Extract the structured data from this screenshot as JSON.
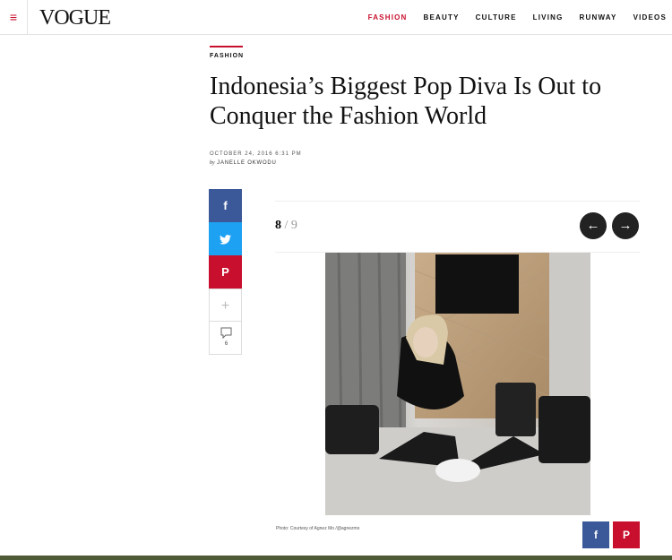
{
  "header": {
    "logo": "VOGUE",
    "menu_icon": "≡",
    "nav": [
      "FASHION",
      "BEAUTY",
      "CULTURE",
      "LIVING",
      "RUNWAY",
      "VIDEOS"
    ],
    "active_nav": "FASHION",
    "accent_color": "#c8102e"
  },
  "article": {
    "category": "FASHION",
    "headline": "Indonesia’s Biggest Pop Diva Is Out to Conquer the Fashion World",
    "date": "OCTOBER 24, 2016 6:31 PM",
    "by": "by",
    "author": "JANELLE OKWODU"
  },
  "share": {
    "facebook": "f",
    "twitter": "t",
    "pinterest": "P",
    "more": "+",
    "comment_count": "6"
  },
  "gallery": {
    "current": "8",
    "separator": "/",
    "total": "9",
    "prev_icon": "←",
    "next_icon": "→",
    "caption": "Photo: Courtesy of Agnez Mo /@agnezmo"
  }
}
